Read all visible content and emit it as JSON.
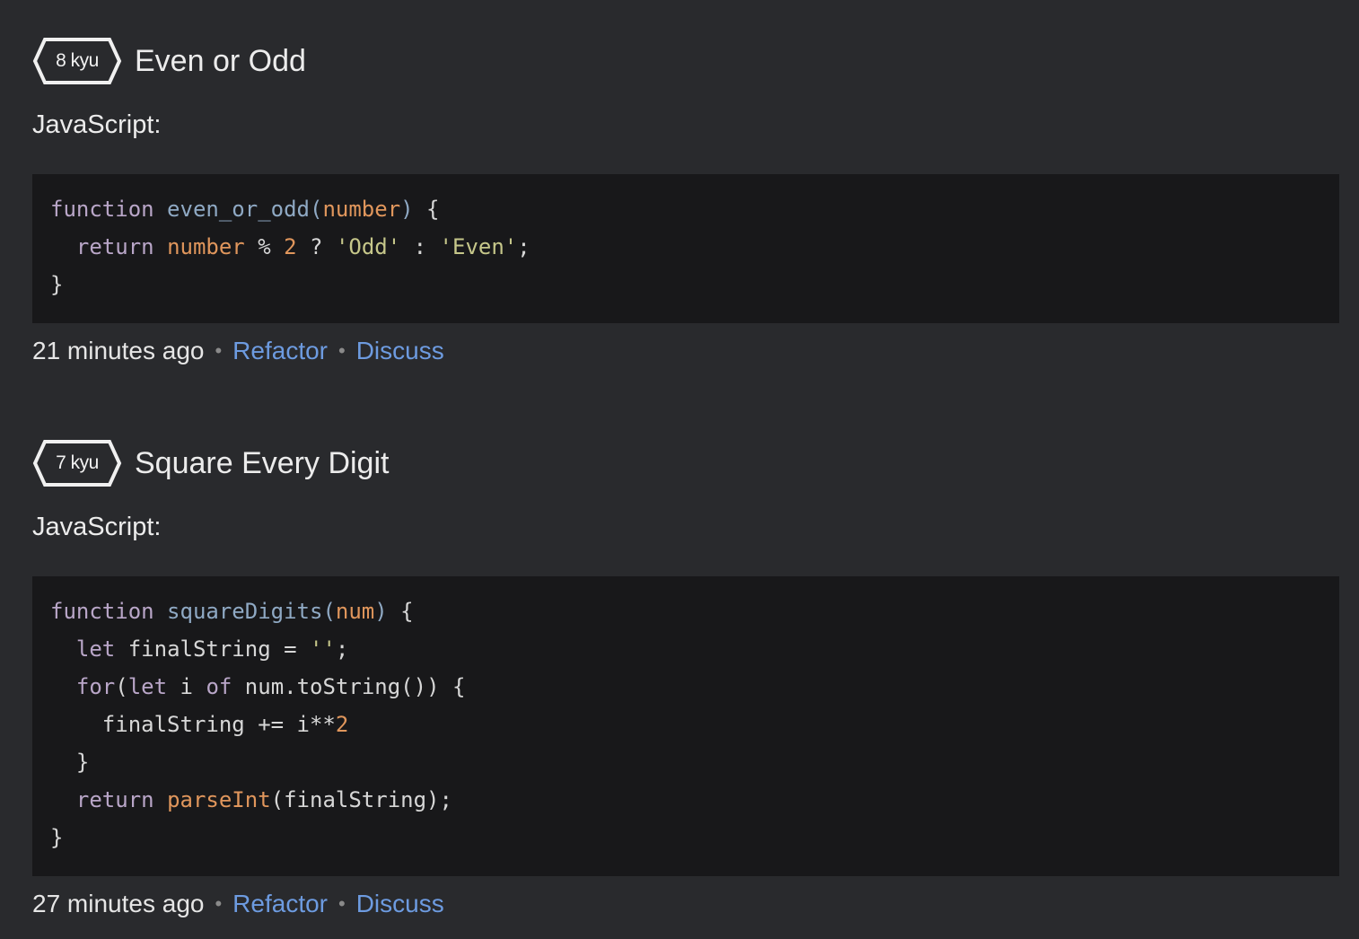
{
  "katas": [
    {
      "rank": "8 kyu",
      "title": "Even or Odd",
      "language": "JavaScript:",
      "code_lines": [
        [
          [
            "kw",
            "function"
          ],
          [
            "plain",
            " "
          ],
          [
            "fn",
            "even_or_odd"
          ],
          [
            "fn",
            "("
          ],
          [
            "param",
            "number"
          ],
          [
            "fn",
            ")"
          ],
          [
            "plain",
            " {"
          ]
        ],
        [
          [
            "plain",
            "  "
          ],
          [
            "kw",
            "return"
          ],
          [
            "plain",
            " "
          ],
          [
            "param",
            "number"
          ],
          [
            "plain",
            " % "
          ],
          [
            "num",
            "2"
          ],
          [
            "plain",
            " ? "
          ],
          [
            "str",
            "'Odd'"
          ],
          [
            "plain",
            " : "
          ],
          [
            "str",
            "'Even'"
          ],
          [
            "plain",
            ";"
          ]
        ],
        [
          [
            "plain",
            "}"
          ]
        ]
      ],
      "time": "21 minutes ago",
      "separator": "•",
      "refactor_label": "Refactor",
      "discuss_label": "Discuss"
    },
    {
      "rank": "7 kyu",
      "title": "Square Every Digit",
      "language": "JavaScript:",
      "code_lines": [
        [
          [
            "kw",
            "function"
          ],
          [
            "plain",
            " "
          ],
          [
            "fn",
            "squareDigits"
          ],
          [
            "fn",
            "("
          ],
          [
            "param",
            "num"
          ],
          [
            "fn",
            ")"
          ],
          [
            "plain",
            " {"
          ]
        ],
        [
          [
            "plain",
            "  "
          ],
          [
            "kw",
            "let"
          ],
          [
            "plain",
            " finalString = "
          ],
          [
            "str",
            "''"
          ],
          [
            "plain",
            ";"
          ]
        ],
        [
          [
            "plain",
            "  "
          ],
          [
            "kw",
            "for"
          ],
          [
            "plain",
            "("
          ],
          [
            "kw",
            "let"
          ],
          [
            "plain",
            " i "
          ],
          [
            "kw",
            "of"
          ],
          [
            "plain",
            " num.toString()) {"
          ]
        ],
        [
          [
            "plain",
            "    finalString += i**"
          ],
          [
            "num",
            "2"
          ]
        ],
        [
          [
            "plain",
            "  }"
          ]
        ],
        [
          [
            "plain",
            "  "
          ],
          [
            "kw",
            "return"
          ],
          [
            "plain",
            " "
          ],
          [
            "builtin",
            "parseInt"
          ],
          [
            "plain",
            "(finalString);"
          ]
        ],
        [
          [
            "plain",
            "}"
          ]
        ]
      ],
      "time": "27 minutes ago",
      "separator": "•",
      "refactor_label": "Refactor",
      "discuss_label": "Discuss"
    }
  ],
  "colors": {
    "background": "#292a2d",
    "code_background": "#18181a",
    "link": "#6d9be0",
    "keyword": "#b9a6c8",
    "function_name": "#8fa9c4",
    "parameter": "#e0965c",
    "string": "#c6c78a"
  },
  "icons": {
    "rank_badge": "hexagon-outline-icon"
  }
}
